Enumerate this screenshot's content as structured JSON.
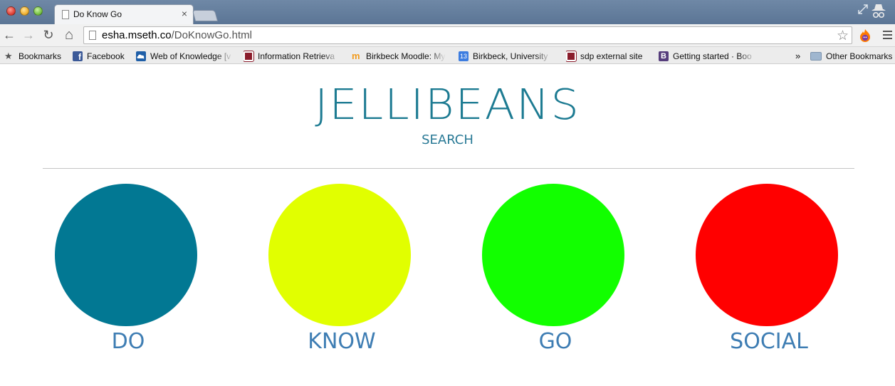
{
  "browser": {
    "tab_title": "Do Know Go",
    "tab_close": "×",
    "url_host": "esha.mseth.co",
    "url_path": "/DoKnowGo.html",
    "nav": {
      "back": "←",
      "forward": "→",
      "reload": "↻",
      "home": "⌂"
    },
    "star": "☆"
  },
  "bookmarks": {
    "items": [
      {
        "label": "Bookmarks",
        "icon": "star-icon"
      },
      {
        "label": "Facebook",
        "icon": "facebook-icon",
        "color": "#3b5998"
      },
      {
        "label": "Web of Knowledge [v",
        "icon": "cloud-icon",
        "color": "#1f5fa8"
      },
      {
        "label": "Information Retrieva",
        "icon": "library-icon",
        "color": "#8a1c2b"
      },
      {
        "label": "Birkbeck Moodle: My",
        "icon": "moodle-icon",
        "color": "#f29a1c"
      },
      {
        "label": "Birkbeck, University",
        "icon": "calendar-icon",
        "color": "#3d7de0"
      },
      {
        "label": "sdp external site",
        "icon": "library-icon",
        "color": "#8a1c2b"
      },
      {
        "label": "Getting started · Boo",
        "icon": "bootstrap-icon",
        "color": "#563d7c"
      }
    ],
    "overflow": "»",
    "other": "Other Bookmarks",
    "calendar_day": "13",
    "bootstrap_letter": "B"
  },
  "page": {
    "title": "JELLIBEANS",
    "search": "SEARCH",
    "circles": [
      {
        "label": "DO",
        "color": "#027893"
      },
      {
        "label": "KNOW",
        "color": "#e1ff00"
      },
      {
        "label": "GO",
        "color": "#12ff00"
      },
      {
        "label": "SOCIAL",
        "color": "#ff0000"
      }
    ]
  }
}
